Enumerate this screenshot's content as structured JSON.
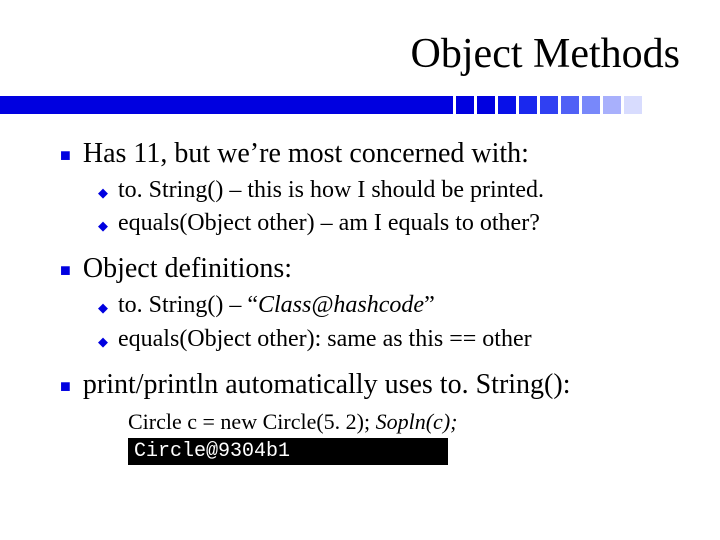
{
  "title": "Object Methods",
  "bullets": {
    "b1": {
      "text": "Has 11, but we’re most concerned with:"
    },
    "b1a": {
      "text": "to. String() – this is how I should be printed."
    },
    "b1b": {
      "text": "equals(Object other) – am I equals to other?"
    },
    "b2": {
      "text": "Object definitions:"
    },
    "b2a": {
      "prefix": "to. String() – “",
      "italic": "Class@hashcode",
      "suffix": "”"
    },
    "b2b": {
      "text": "equals(Object other): same as this == other"
    },
    "b3": {
      "text": "print/println automatically uses to. String():"
    }
  },
  "code": {
    "line1_plain": "Circle c = new Circle(5. 2); ",
    "line1_italic": "Sopln(c);",
    "console": "Circle@9304b1"
  },
  "decor_colors": [
    "#0000e0",
    "#0000e0",
    "#0000e0",
    "#0810e8",
    "#1a28ee",
    "#3040f2",
    "#5060f6",
    "#7888fa",
    "#a8b0fc",
    "#d8dcfe"
  ]
}
